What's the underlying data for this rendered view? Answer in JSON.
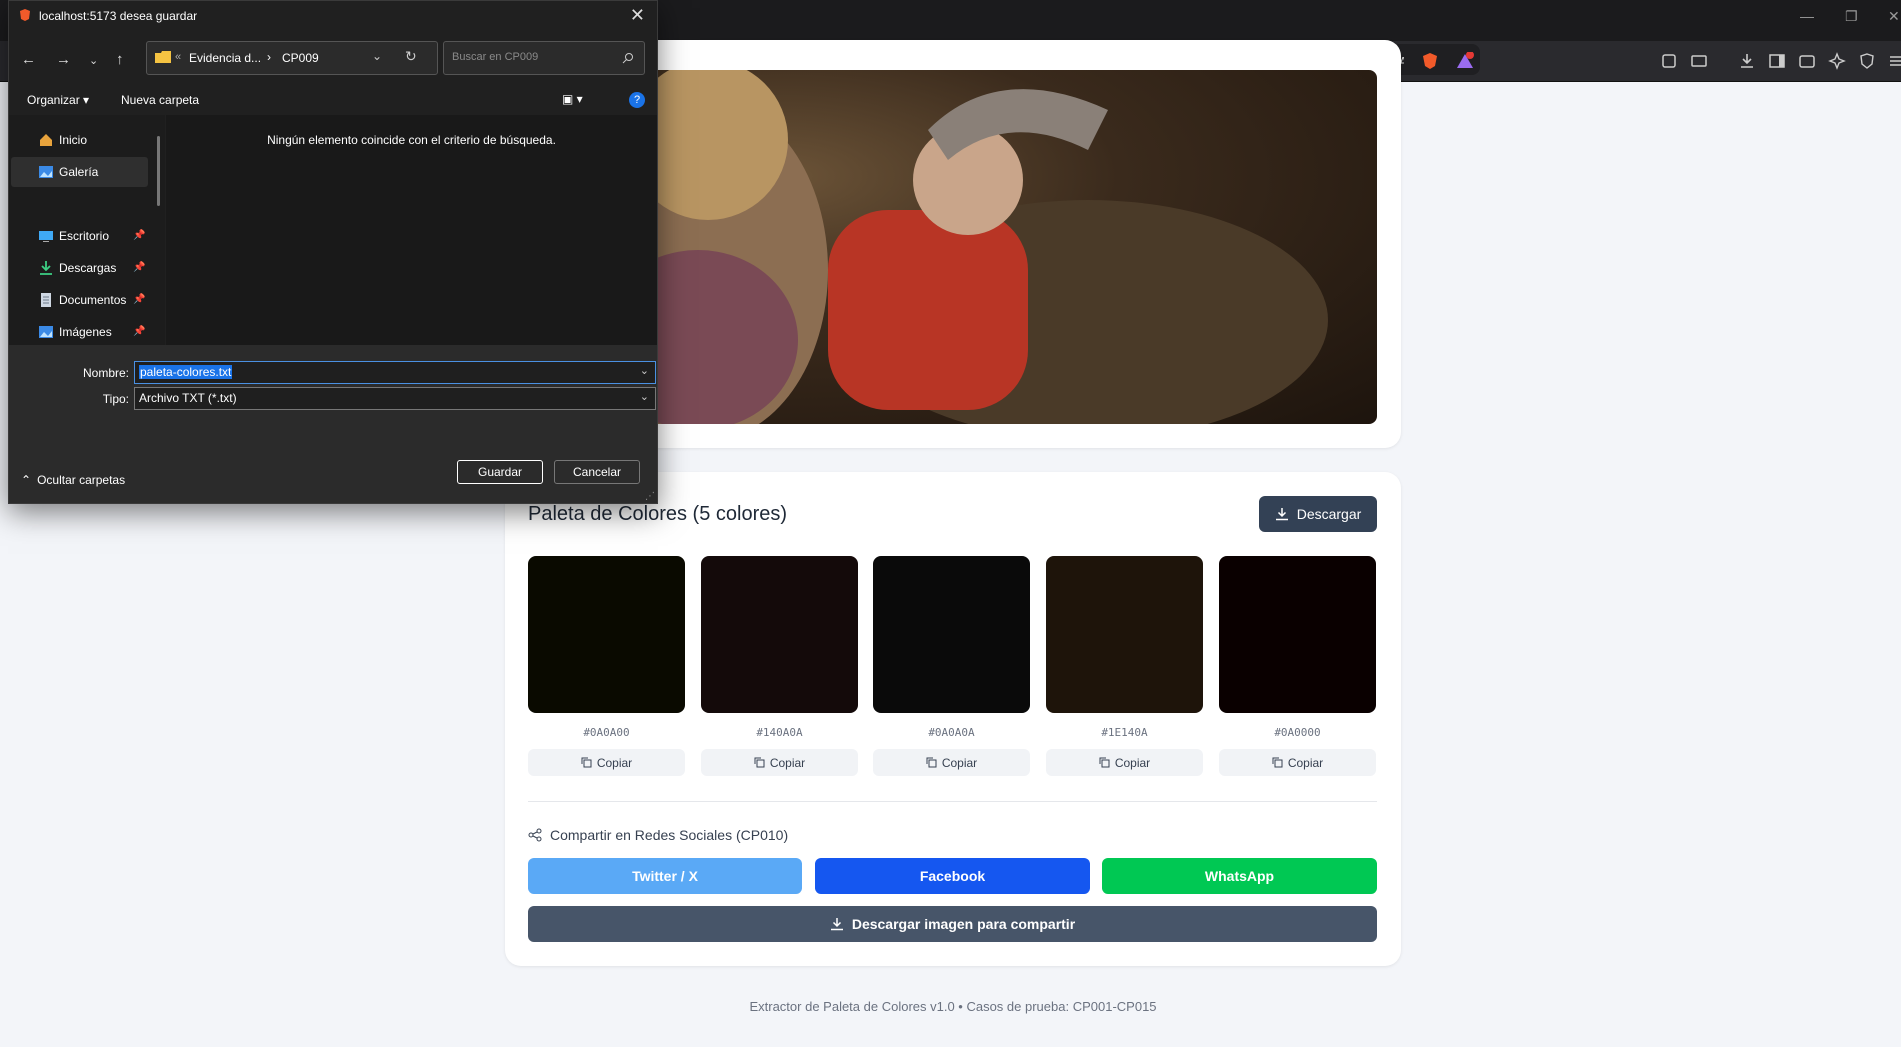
{
  "browser": {
    "window_controls": [
      "—",
      "❐",
      "✕"
    ]
  },
  "dialog": {
    "title": "localhost:5173 desea guardar",
    "breadcrumb": {
      "prefix": "«",
      "folder": "Evidencia d...",
      "separator": "›",
      "current": "CP009"
    },
    "search_placeholder": "Buscar en CP009",
    "toolbar": {
      "organize": "Organizar",
      "new_folder": "Nueva carpeta"
    },
    "sidebar": [
      {
        "label": "Inicio",
        "icon": "home-icon"
      },
      {
        "label": "Galería",
        "icon": "gallery-icon"
      },
      {
        "label": "Escritorio",
        "icon": "desktop-icon"
      },
      {
        "label": "Descargas",
        "icon": "download-icon"
      },
      {
        "label": "Documentos",
        "icon": "document-icon"
      },
      {
        "label": "Imágenes",
        "icon": "pictures-icon"
      }
    ],
    "empty_message": "Ningún elemento coincide con el criterio de búsqueda.",
    "filename_label": "Nombre:",
    "filename_value": "paleta-colores.txt",
    "type_label": "Tipo:",
    "type_value": "Archivo TXT (*.txt)",
    "hide_folders": "Ocultar carpetas",
    "save_label": "Guardar",
    "cancel_label": "Cancelar"
  },
  "palette": {
    "title": "Paleta de Colores (5 colores)",
    "download_label": "Descargar",
    "colors": [
      {
        "hex": "#0A0A00",
        "copy": "Copiar"
      },
      {
        "hex": "#140A0A",
        "copy": "Copiar"
      },
      {
        "hex": "#0A0A0A",
        "copy": "Copiar"
      },
      {
        "hex": "#1E140A",
        "copy": "Copiar"
      },
      {
        "hex": "#0A0000",
        "copy": "Copiar"
      }
    ]
  },
  "share": {
    "title": "Compartir en Redes Sociales (CP010)",
    "buttons": [
      {
        "label": "Twitter / X",
        "color": "#5aa9f6"
      },
      {
        "label": "Facebook",
        "color": "#1557f0"
      },
      {
        "label": "WhatsApp",
        "color": "#00c853"
      }
    ],
    "download_image": "Descargar imagen para compartir"
  },
  "footer": "Extractor de Paleta de Colores v1.0 • Casos de prueba: CP001-CP015"
}
